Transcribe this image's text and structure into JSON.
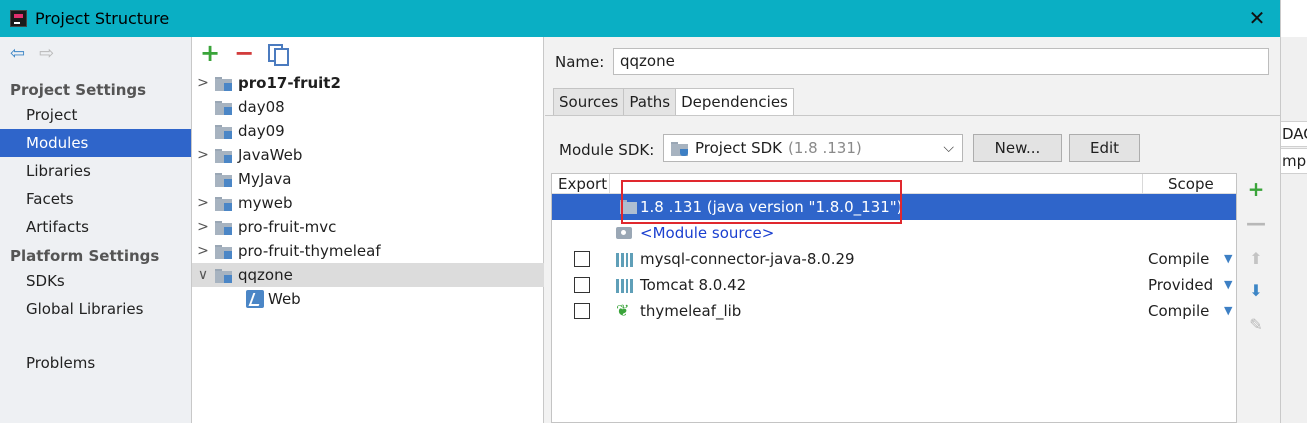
{
  "window": {
    "title": "Project Structure",
    "close_glyph": "✕"
  },
  "background_window": {
    "cell1": "DAO",
    "cell2": "mpl."
  },
  "nav": {
    "project_settings_header": "Project Settings",
    "project_settings_items": [
      "Project",
      "Modules",
      "Libraries",
      "Facets",
      "Artifacts"
    ],
    "platform_settings_header": "Platform Settings",
    "platform_settings_items": [
      "SDKs",
      "Global Libraries"
    ],
    "problems": "Problems",
    "selected": "Modules"
  },
  "tree": {
    "toolbar": {
      "add": "+",
      "remove": "−"
    },
    "items": [
      {
        "label": "pro17-fruit2",
        "bold": true,
        "expandable": true
      },
      {
        "label": "day08",
        "expandable": false
      },
      {
        "label": "day09",
        "expandable": false
      },
      {
        "label": "JavaWeb",
        "expandable": true
      },
      {
        "label": "MyJava",
        "expandable": false
      },
      {
        "label": "myweb",
        "expandable": true
      },
      {
        "label": "pro-fruit-mvc",
        "expandable": true
      },
      {
        "label": "pro-fruit-thymeleaf",
        "expandable": true
      },
      {
        "label": "qqzone",
        "expandable": true,
        "expanded": true,
        "selected": true
      },
      {
        "label": "Web",
        "child": true
      }
    ]
  },
  "detail": {
    "name_label": "Name:",
    "name_value": "qqzone",
    "tabs": [
      "Sources",
      "Paths",
      "Dependencies"
    ],
    "active_tab": "Dependencies",
    "module_sdk_label": "Module SDK:",
    "sdk_value": "Project SDK",
    "sdk_version": "(1.8 .131)",
    "new_button": "New...",
    "edit_button": "Edit",
    "table": {
      "col_export": "Export",
      "col_scope": "Scope",
      "rows": [
        {
          "name": "1.8 .131 (java version \"1.8.0_131\")",
          "selected": true,
          "checkbox": false,
          "scope": ""
        },
        {
          "name": "<Module source>",
          "link": true,
          "checkbox": false,
          "scope": ""
        },
        {
          "name": "mysql-connector-java-8.0.29",
          "checkbox": true,
          "scope": "Compile"
        },
        {
          "name": "Tomcat 8.0.42",
          "checkbox": true,
          "scope": "Provided"
        },
        {
          "name": "thymeleaf_lib",
          "checkbox": true,
          "scope": "Compile"
        }
      ]
    },
    "highlight_color": "#e0282e",
    "selection_color": "#2f65ca"
  }
}
